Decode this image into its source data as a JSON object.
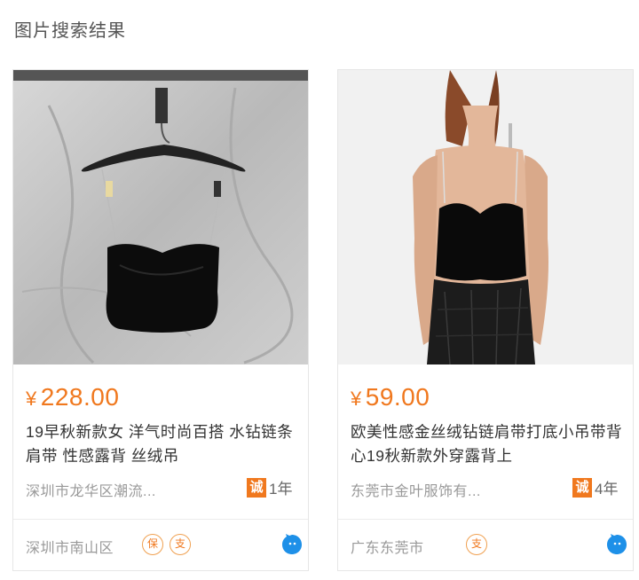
{
  "page": {
    "title": "图片搜索结果"
  },
  "results": [
    {
      "price_currency": "¥",
      "price_value": "228.00",
      "title": "19早秋新款女 洋气时尚百搭 水钻链条肩带 性感露背 丝绒吊",
      "company": "深圳市龙华区潮流...",
      "cheng_label": "诚",
      "cheng_years": "1年",
      "location": "深圳市南山区",
      "badges": [
        "保",
        "支"
      ]
    },
    {
      "price_currency": "¥",
      "price_value": "59.00",
      "title": "欧美性感金丝绒钻链肩带打底小吊带背心19秋新款外穿露背上",
      "company": "东莞市金叶服饰有...",
      "cheng_label": "诚",
      "cheng_years": "4年",
      "location": "广东东莞市",
      "badges": [
        "支"
      ]
    }
  ],
  "colors": {
    "price": "#f0781e",
    "accent": "#f0781e",
    "chat_icon": "#1e90e8"
  },
  "icons": {
    "chat": "wangwang-chat-icon",
    "cheng": "chengxintong-icon"
  }
}
